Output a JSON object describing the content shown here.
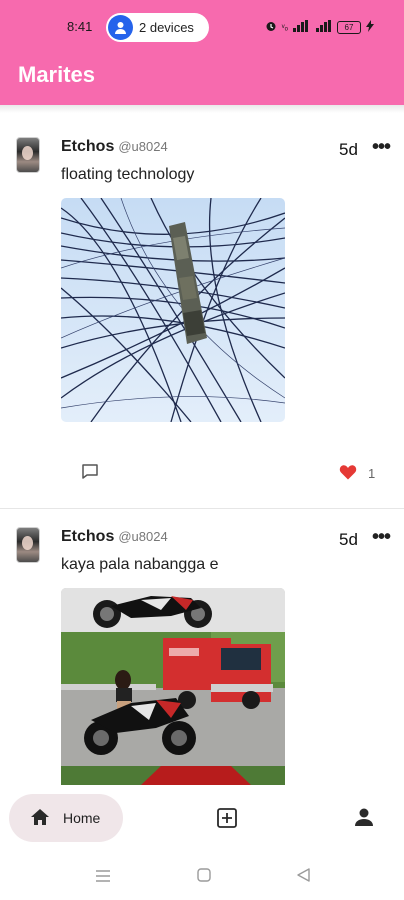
{
  "status_bar": {
    "time": "8:41",
    "devices_label": "2 devices",
    "battery": "67"
  },
  "app": {
    "title": "Marites"
  },
  "posts": [
    {
      "author": "Etchos",
      "handle": "@u8024",
      "age": "5d",
      "text": "floating technology",
      "likes": "1",
      "image": "tangled overhead power lines on a utility pole against a blue sky"
    },
    {
      "author": "Etchos",
      "handle": "@u8024",
      "age": "5d",
      "text": "kaya pala nabangga e",
      "likes": "",
      "image": "motorcycles, a red delivery truck and a person sitting on a road"
    }
  ],
  "nav": {
    "home_label": "Home"
  },
  "colors": {
    "accent": "#f76aae",
    "like": "#e53935",
    "home_pill": "#f0e6e9"
  }
}
